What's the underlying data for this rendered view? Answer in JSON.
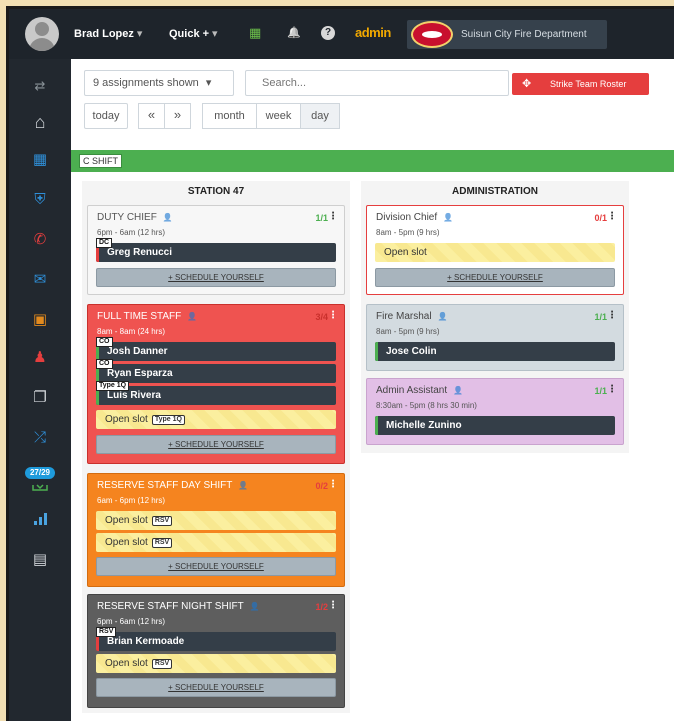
{
  "topbar": {
    "user_name": "Brad Lopez",
    "user_caret": "▾",
    "quick_label": "Quick +",
    "quick_caret": "▾",
    "admin_label": "admin",
    "department": "Suisun City Fire Department"
  },
  "icons": {
    "calendar": "▦",
    "bell": "🔔",
    "help": "?",
    "transfer": "⇄",
    "home": "⌂",
    "schedule": "▦",
    "shield": "⛨",
    "phone": "✆",
    "mail": "✉",
    "briefcase": "▣",
    "user_remove": "♟",
    "copy": "❐",
    "shuffle": "⤮",
    "report": "▤",
    "person_add": "👤",
    "menu": "⋮",
    "crosshair": "✥"
  },
  "sidebar": {
    "badge": "27/29"
  },
  "toolbar": {
    "assignments_label": "9 assignments shown",
    "assignments_caret": "▾",
    "search_placeholder": "Search...",
    "strike_label": "Strike Team Roster",
    "today": "today",
    "prev": "«",
    "next": "»",
    "month": "month",
    "week": "week",
    "day": "day"
  },
  "shift": {
    "label": "C SHIFT",
    "color": "#4caf50"
  },
  "schedule_yourself": "+ SCHEDULE YOURSELF",
  "stations": [
    {
      "name": "STATION 47",
      "groups": [
        {
          "title": "DUTY CHIEF",
          "count": "1/1",
          "hours": "6pm - 6am (12 hrs)",
          "slots": [
            {
              "role": "DC",
              "name": "Greg Renucci"
            }
          ]
        },
        {
          "title": "FULL TIME STAFF",
          "count": "3/4",
          "hours": "8am - 8am (24 hrs)",
          "slots": [
            {
              "role": "CO",
              "name": "Josh Danner"
            },
            {
              "role": "CO",
              "name": "Ryan Esparza"
            },
            {
              "role": "Type 1Q",
              "name": "Luis Rivera"
            },
            {
              "open": "Open slot",
              "tag": "Type 1Q"
            }
          ]
        },
        {
          "title": "RESERVE STAFF DAY SHIFT",
          "count": "0/2",
          "hours": "6am - 6pm (12 hrs)",
          "slots": [
            {
              "open": "Open slot",
              "tag": "RSV"
            },
            {
              "open": "Open slot",
              "tag": "RSV"
            }
          ]
        },
        {
          "title": "RESERVE STAFF NIGHT SHIFT",
          "count": "1/2",
          "hours": "6pm - 6am (12 hrs)",
          "slots": [
            {
              "role": "RSV",
              "name": "Brian Kermoade"
            },
            {
              "open": "Open slot",
              "tag": "RSV"
            }
          ]
        }
      ]
    },
    {
      "name": "ADMINISTRATION",
      "groups": [
        {
          "title": "Division Chief",
          "count": "0/1",
          "hours": "8am - 5pm (9 hrs)",
          "slots": [
            {
              "open": "Open slot"
            }
          ]
        },
        {
          "title": "Fire Marshal",
          "count": "1/1",
          "hours": "8am - 5pm (9 hrs)",
          "slots": [
            {
              "name": "Jose Colin"
            }
          ]
        },
        {
          "title": "Admin Assistant",
          "count": "1/1",
          "hours": "8:30am - 5pm (8 hrs 30 min)",
          "slots": [
            {
              "name": "Michelle Zunino"
            }
          ]
        }
      ]
    }
  ],
  "colors": {
    "topbar": "#1e242b",
    "sidebar": "#22282f",
    "duty_chief": "#f7f7f7",
    "full_time": "#ef5350",
    "reserve_day": "#f5841f",
    "reserve_night": "#5e5e5e",
    "fire_marshal": "#d3dbe0",
    "admin_assistant": "#e2bfe6",
    "strike_button": "#e53e3e"
  }
}
